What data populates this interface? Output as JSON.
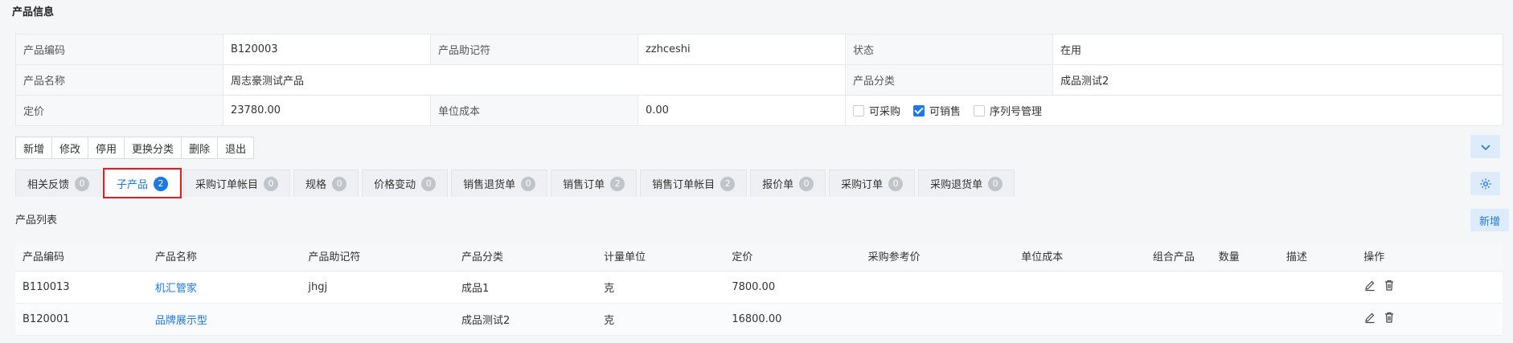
{
  "page": {
    "title": "产品信息"
  },
  "info": {
    "row1": [
      {
        "label": "产品编码",
        "value": "B120003"
      },
      {
        "label": "产品助记符",
        "value": "zzhceshi"
      },
      {
        "label": "状态",
        "value": "在用"
      }
    ],
    "row2": [
      {
        "label": "产品名称",
        "value": "周志豪测试产品"
      },
      {
        "label": "产品分类",
        "value": "成品测试2"
      }
    ],
    "row3": [
      {
        "label": "定价",
        "value": "23780.00"
      },
      {
        "label": "单位成本",
        "value": "0.00"
      }
    ],
    "checkboxes": [
      {
        "label": "可采购",
        "checked": false
      },
      {
        "label": "可销售",
        "checked": true
      },
      {
        "label": "序列号管理",
        "checked": false
      }
    ]
  },
  "toolbar": {
    "buttons": [
      "新增",
      "修改",
      "停用",
      "更换分类",
      "删除",
      "退出"
    ]
  },
  "tabs": [
    {
      "label": "相关反馈",
      "count": "0",
      "active": false
    },
    {
      "label": "子产品",
      "count": "2",
      "active": true
    },
    {
      "label": "采购订单帐目",
      "count": "0",
      "active": false
    },
    {
      "label": "规格",
      "count": "0",
      "active": false
    },
    {
      "label": "价格变动",
      "count": "0",
      "active": false
    },
    {
      "label": "销售退货单",
      "count": "0",
      "active": false
    },
    {
      "label": "销售订单",
      "count": "2",
      "active": false
    },
    {
      "label": "销售订单帐目",
      "count": "2",
      "active": false
    },
    {
      "label": "报价单",
      "count": "0",
      "active": false
    },
    {
      "label": "采购订单",
      "count": "0",
      "active": false
    },
    {
      "label": "采购退货单",
      "count": "0",
      "active": false
    }
  ],
  "product_list": {
    "title": "产品列表",
    "add_label": "新增",
    "columns": [
      "产品编码",
      "产品名称",
      "产品助记符",
      "产品分类",
      "计量单位",
      "定价",
      "采购参考价",
      "单位成本",
      "组合产品",
      "数量",
      "描述",
      "操作"
    ],
    "rows": [
      [
        "B110013",
        "机汇管家",
        "jhgj",
        "成品1",
        "克",
        "7800.00",
        "",
        "",
        "",
        "",
        ""
      ],
      [
        "B120001",
        "品牌展示型",
        "",
        "成品测试2",
        "克",
        "16800.00",
        "",
        "",
        "",
        "",
        ""
      ]
    ]
  },
  "colors": {
    "accent": "#1e78e4",
    "highlight": "#e02020"
  }
}
